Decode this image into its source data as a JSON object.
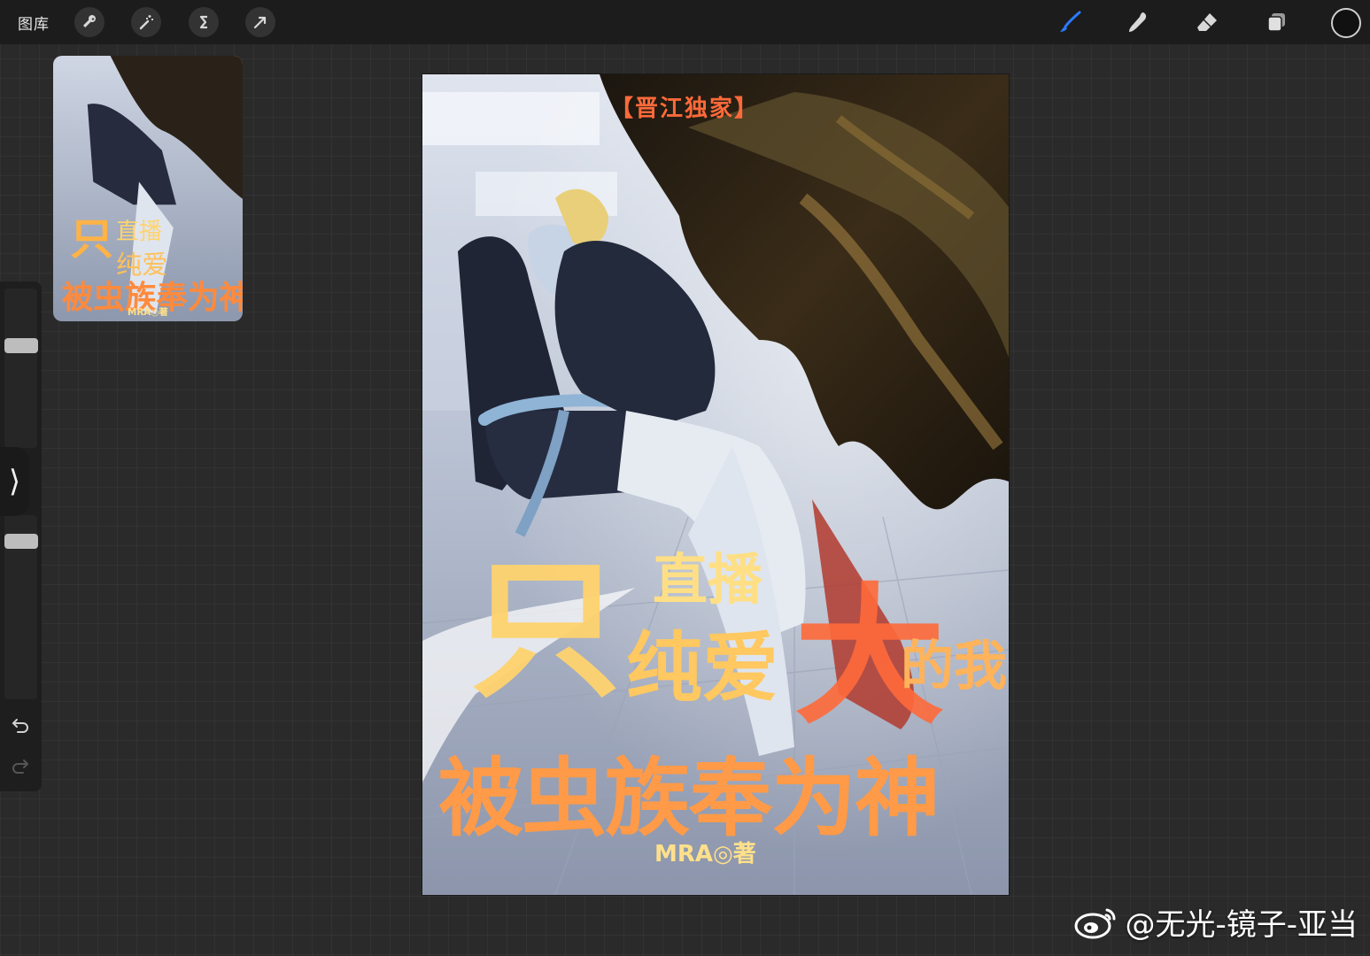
{
  "toolbar": {
    "gallery_label": "图库",
    "left_tools": [
      {
        "name": "actions",
        "icon": "wrench-icon"
      },
      {
        "name": "adjustments",
        "icon": "magic-wand-icon"
      },
      {
        "name": "selection",
        "icon": "selection-s-icon"
      },
      {
        "name": "transform",
        "icon": "arrow-cursor-icon"
      }
    ],
    "right_tools": [
      {
        "name": "brush",
        "icon": "brush-icon",
        "active": true
      },
      {
        "name": "smudge",
        "icon": "smudge-finger-icon"
      },
      {
        "name": "eraser",
        "icon": "eraser-icon"
      },
      {
        "name": "layers",
        "icon": "layers-icon"
      }
    ],
    "active_color": "#111111",
    "accent_color": "#2a7bff"
  },
  "sidebar": {
    "brush_size": 0.12,
    "opacity": 0.15,
    "expander_glyph": "⟩",
    "undo_icon": "undo-icon",
    "redo_icon": "redo-icon"
  },
  "artwork": {
    "header_text": "【晋江独家】",
    "title_line1": "直播",
    "title_line2": "纯爱",
    "title_line3": "的我",
    "title_line4": "被虫族奉为神",
    "author": "MRA◎著"
  },
  "watermark": {
    "text": "@无光-镜子-亚当"
  }
}
